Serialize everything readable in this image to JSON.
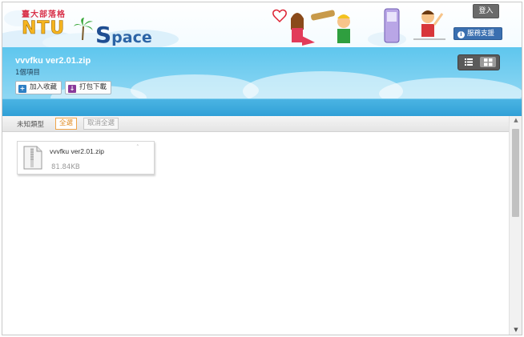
{
  "header": {
    "logo_tagline": "臺大部落格",
    "logo_ntu": "NTU",
    "logo_space_cap": "S",
    "logo_space_rest": "pace",
    "login_label": "登入",
    "support_label": "服務支援"
  },
  "folder": {
    "title": "vvvfku ver2.01.zip",
    "item_count": "1個項目",
    "add_favorite_label": "加入收藏",
    "download_label": "打包下載"
  },
  "filter": {
    "type_label": "未知類型",
    "select_all_label": "全選",
    "deselect_all_label": "取消全選"
  },
  "files": [
    {
      "name": "vvvfku ver2.01.zip",
      "size": "81.84KB",
      "close_glyph": "˄"
    }
  ],
  "colors": {
    "band_top": "#5ec6ee",
    "strip": "#2f9fd6",
    "select_accent": "#e08a20",
    "support_button": "#3a6fb0"
  },
  "icons": {
    "add_favorite": "plus-square-icon",
    "download": "download-box-icon",
    "list_view": "list-view-icon",
    "grid_view": "grid-view-icon",
    "file": "zip-file-icon"
  }
}
